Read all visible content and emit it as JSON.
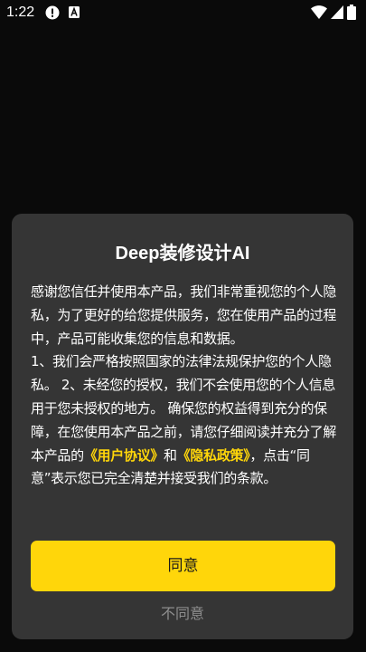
{
  "status_bar": {
    "time": "1:22",
    "icons": [
      "alert-icon",
      "text-a-icon",
      "wifi-icon",
      "signal-icon",
      "battery-icon"
    ]
  },
  "dialog": {
    "title": "Deep装修设计AI",
    "body": {
      "paragraph_1": "感谢您信任并使用本产品，我们非常重视您的个人隐私，为了更好的给您提供服务，您在使用产品的过程中，产品可能收集您的信息和数据。",
      "paragraph_2_before": "1、我们会严格按照国家的法律法规保护您的个人隐私。 2、未经您的授权，我们不会使用您的个人信息用于您未授权的地方。 确保您的权益得到充分的保障，在您使用本产品之前，请您仔细阅读并充分了解本产品的",
      "user_agreement_link": "《用户协议》",
      "conjunction": "和",
      "privacy_policy_link": "《隐私政策》",
      "paragraph_2_after": "，点击“同意”表示您已完全清楚并接受我们的条款。"
    },
    "agree_label": "同意",
    "disagree_label": "不同意"
  },
  "colors": {
    "background": "#0a0a0a",
    "dialog": "#353535",
    "accent": "#ffd60a",
    "muted_text": "#8e8e8e"
  }
}
